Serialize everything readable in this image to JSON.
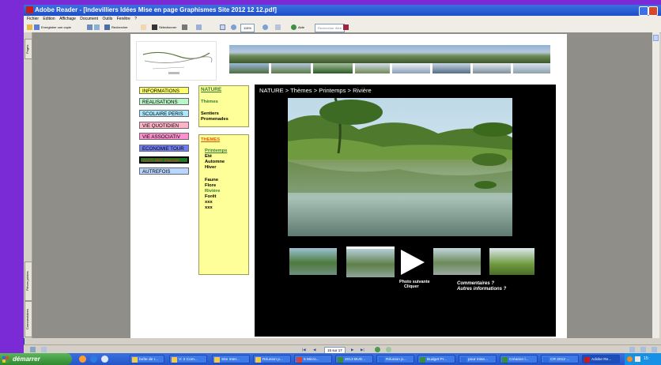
{
  "window": {
    "title": "Adobe Reader - [Indevilliers Idées Mise en page Graphismes Site 2012 12 12.pdf]"
  },
  "menubar": {
    "items": [
      "Fichier",
      "Edition",
      "Affichage",
      "Document",
      "Outils",
      "Fenêtre",
      "?"
    ]
  },
  "toolbar": {
    "save_copy": "Enregistrer une copie",
    "search": "Rechercher",
    "select": "Sélectionner",
    "zoom": "115%",
    "help": "Aide",
    "search_box": "Rechercher Web"
  },
  "sidepanel": {
    "tabs": [
      "Pages",
      "Pièces jointes",
      "Commentaires"
    ]
  },
  "nav_menu": [
    {
      "label": "INFORMATIONS",
      "bg": "#ffff66"
    },
    {
      "label": "REALISATIONS",
      "bg": "#b9f5c8"
    },
    {
      "label": "SCOLAIRE PERIS",
      "bg": "#a8e8ff"
    },
    {
      "label": "VIE QUOTIDIEN",
      "bg": "#ffb3c8"
    },
    {
      "label": "VIE ASSOCIATIV",
      "bg": "#ff8fd0"
    },
    {
      "label": "ECONOMIE TOUR",
      "bg": "#6f7cf0"
    },
    {
      "label": "NATURE ENVIR",
      "bg": "#1f7a1f"
    },
    {
      "label": "AUTREFOIS",
      "bg": "#b8d6ff"
    }
  ],
  "nature_box": {
    "heading": "NATURE",
    "items": [
      "Thèmes",
      "Sentiers",
      "Promenades"
    ]
  },
  "themes_box": {
    "heading": "THEMES",
    "seasons": [
      "Printemps",
      "Eté",
      "Automne",
      "Hiver"
    ],
    "topics": [
      "Faune",
      "Flore",
      "Rivière",
      "Forêt",
      "xxx",
      "xxx"
    ]
  },
  "main": {
    "breadcrumb": "NATURE > Thèmes > Printemps > Rivière",
    "next_photo": "Photo suivante",
    "click": "Cliquer",
    "comments": "Commentaires ?",
    "other_info": "Autres informations ?"
  },
  "pagenav": {
    "page_indicator": "15 sur 17"
  },
  "taskbar": {
    "start": "démarrer",
    "tasks": [
      "boîte de r...",
      "V: 2 Com...",
      "Site Inter...",
      "Réunion p...",
      "5 Micro...",
      "2013 BUD...",
      "Réunion p...",
      "Budget Pr...",
      "pour mise...",
      "Création l...",
      "CR 2012 ...",
      "Adobe Re..."
    ],
    "clock": "15:"
  }
}
